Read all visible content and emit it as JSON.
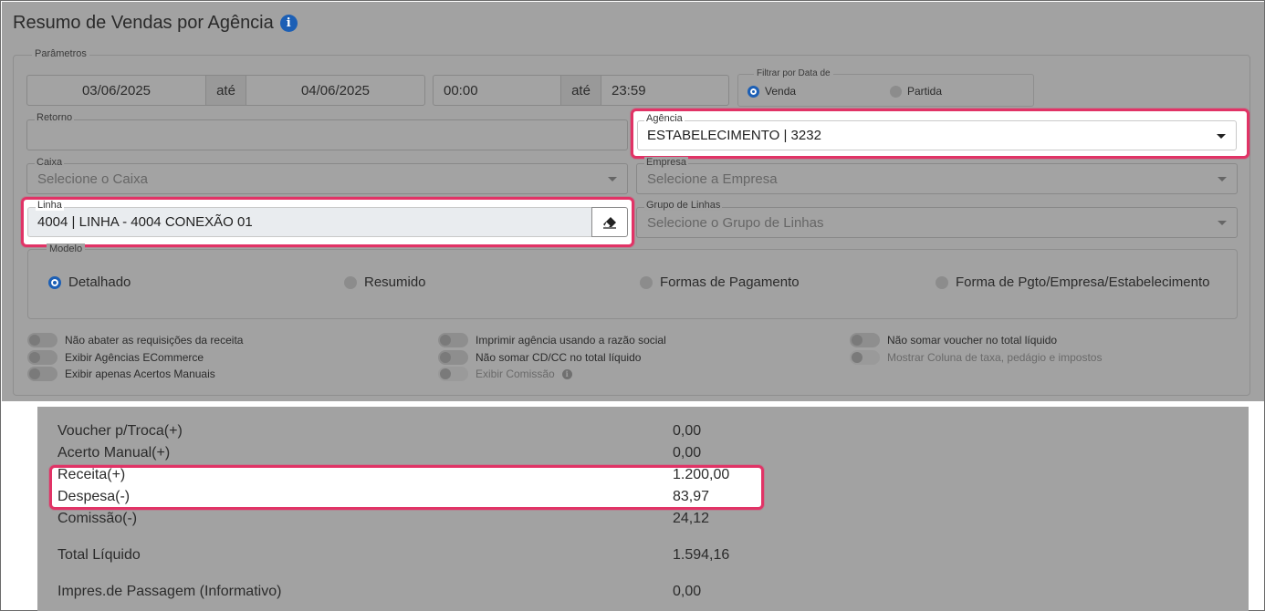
{
  "header": {
    "title": "Resumo de Vendas por Agência"
  },
  "parametros": {
    "legend": "Parâmetros",
    "data_inicio": "03/06/2025",
    "data_ate_label": "até",
    "data_fim": "04/06/2025",
    "hora_inicio": "00:00",
    "hora_ate_label": "até",
    "hora_fim": "23:59",
    "filtro": {
      "legend": "Filtrar por Data de",
      "opcoes": [
        {
          "label": "Venda",
          "selected": true
        },
        {
          "label": "Partida",
          "selected": false
        }
      ]
    },
    "retorno": {
      "label": "Retorno",
      "value": ""
    },
    "agencia": {
      "label": "Agência",
      "value": "ESTABELECIMENTO | 3232"
    },
    "caixa": {
      "label": "Caixa",
      "placeholder": "Selecione o Caixa"
    },
    "empresa": {
      "label": "Empresa",
      "placeholder": "Selecione a Empresa"
    },
    "linha": {
      "label": "Linha",
      "value": "4004 | LINHA - 4004 CONEXÃO 01"
    },
    "grupo_linhas": {
      "label": "Grupo de Linhas",
      "placeholder": "Selecione o Grupo de Linhas"
    },
    "modelo": {
      "legend": "Modelo",
      "opcoes": [
        {
          "label": "Detalhado",
          "selected": true
        },
        {
          "label": "Resumido",
          "selected": false
        },
        {
          "label": "Formas de Pagamento",
          "selected": false
        },
        {
          "label": "Forma de Pgto/Empresa/Estabelecimento",
          "selected": false
        }
      ]
    },
    "toggles": {
      "col1": [
        "Não abater as requisições da receita",
        "Exibir Agências ECommerce",
        "Exibir apenas Acertos Manuais"
      ],
      "col2": [
        "Imprimir agência usando a razão social",
        "Não somar CD/CC no total líquido",
        "Exibir Comissão"
      ],
      "col3": [
        "Não somar voucher no total líquido",
        "Mostrar Coluna de taxa, pedágio e impostos"
      ]
    }
  },
  "resumo": [
    {
      "label": "Voucher p/Troca(+)",
      "value": "0,00"
    },
    {
      "label": "Acerto Manual(+)",
      "value": "0,00"
    },
    {
      "label": "Receita(+)",
      "value": "1.200,00"
    },
    {
      "label": "Despesa(-)",
      "value": "83,97"
    },
    {
      "label": "Comissão(-)",
      "value": "24,12"
    },
    {
      "label": "Total Líquido",
      "value": "1.594,16"
    },
    {
      "label": "Impres.de Passagem (Informativo)",
      "value": "0,00"
    }
  ],
  "colors": {
    "accent": "#1c5fb5",
    "highlight": "#e13366",
    "overlay": "#a2a2a2"
  }
}
